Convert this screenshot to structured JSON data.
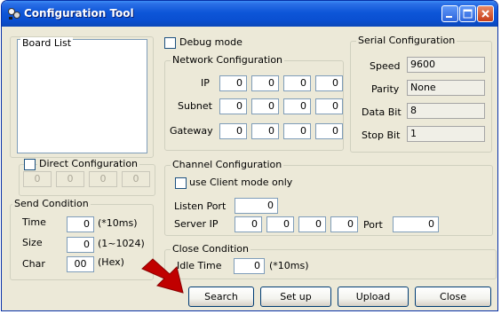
{
  "window": {
    "title": "Configuration Tool"
  },
  "board_list": {
    "label": "Board List"
  },
  "debug_mode": {
    "label": "Debug mode",
    "checked": false
  },
  "network": {
    "title": "Network Configuration",
    "ip_label": "IP",
    "ip": [
      "0",
      "0",
      "0",
      "0"
    ],
    "subnet_label": "Subnet",
    "subnet": [
      "0",
      "0",
      "0",
      "0"
    ],
    "gateway_label": "Gateway",
    "gateway": [
      "0",
      "0",
      "0",
      "0"
    ]
  },
  "serial": {
    "title": "Serial Configuration",
    "speed_label": "Speed",
    "speed": "9600",
    "parity_label": "Parity",
    "parity": "None",
    "databit_label": "Data Bit",
    "databit": "8",
    "stopbit_label": "Stop Bit",
    "stopbit": "1"
  },
  "direct": {
    "label": "Direct Configuration",
    "checked": false,
    "values": [
      "0",
      "0",
      "0",
      "0"
    ]
  },
  "channel": {
    "title": "Channel Configuration",
    "client_mode_label": "use Client mode only",
    "client_mode_checked": false,
    "listen_port_label": "Listen Port",
    "listen_port": "0",
    "server_ip_label": "Server IP",
    "server_ip": [
      "0",
      "0",
      "0",
      "0"
    ],
    "port_label": "Port",
    "port": "0"
  },
  "send": {
    "title": "Send Condition",
    "time_label": "Time",
    "time": "0",
    "time_unit": "(*10ms)",
    "size_label": "Size",
    "size": "0",
    "size_unit": "(1~1024)",
    "char_label": "Char",
    "char": "00",
    "char_unit": "(Hex)"
  },
  "close_cond": {
    "title": "Close Condition",
    "idle_label": "Idle Time",
    "idle": "0",
    "idle_unit": "(*10ms)"
  },
  "buttons": {
    "search": "Search",
    "setup": "Set up",
    "upload": "Upload",
    "close": "Close"
  },
  "colors": {
    "titlebar": "#0a4fd1",
    "arrow": "#c00000",
    "face": "#ece9d8"
  }
}
